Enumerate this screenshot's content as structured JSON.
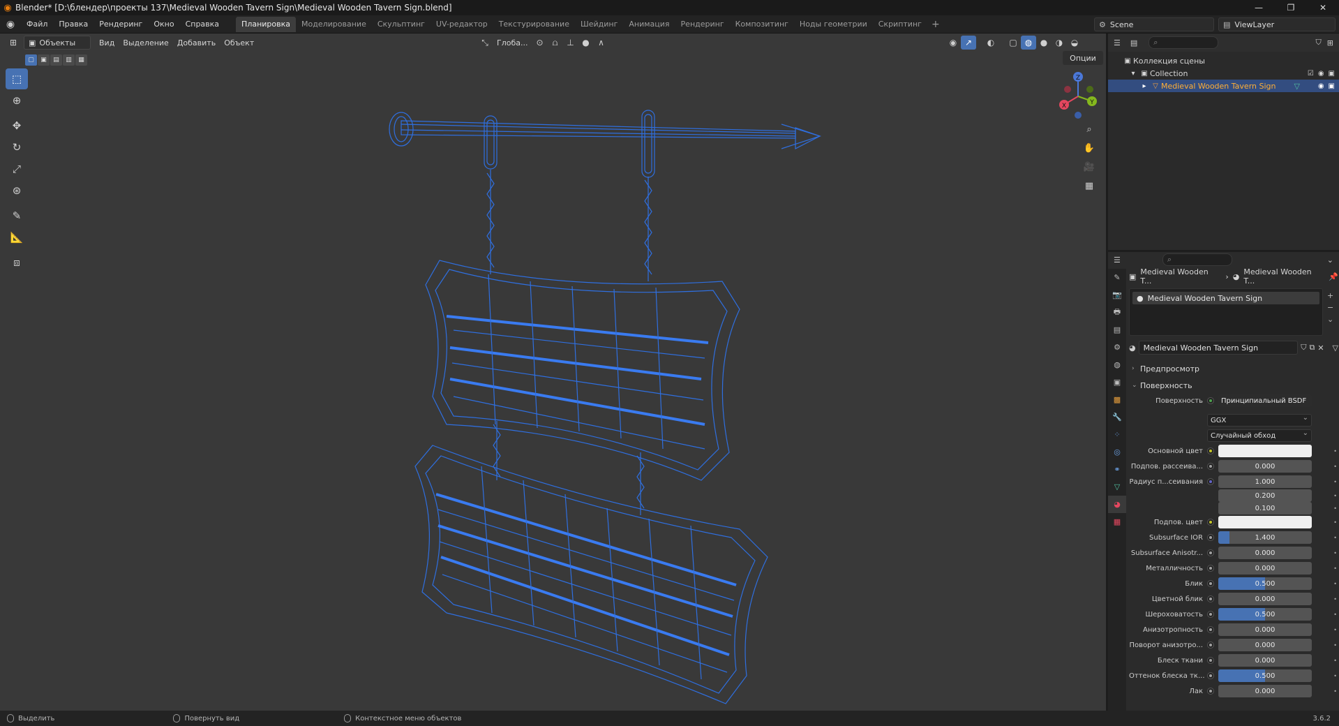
{
  "window": {
    "title": "Blender* [D:\\блендер\\проекты 137\\Medieval Wooden Tavern Sign\\Medieval Wooden Tavern Sign.blend]",
    "controls": [
      "—",
      "❐",
      "✕"
    ]
  },
  "menu": {
    "items": [
      "Файл",
      "Правка",
      "Рендеринг",
      "Окно",
      "Справка"
    ]
  },
  "workspaces": {
    "tabs": [
      "Планировка",
      "Моделирование",
      "Скульптинг",
      "UV-редактор",
      "Текстурирование",
      "Шейдинг",
      "Анимация",
      "Рендеринг",
      "Композитинг",
      "Ноды геометрии",
      "Скриптинг"
    ],
    "active": "Планировка"
  },
  "scene": {
    "name": "Scene"
  },
  "viewlayer": {
    "name": "ViewLayer"
  },
  "viewport": {
    "mode": "Объекты",
    "menus": [
      "Вид",
      "Выделение",
      "Добавить",
      "Объект"
    ],
    "orientation": "Глоба...",
    "options": "Опции",
    "wire_color": "#2f6fe0"
  },
  "gizmo": {
    "x": "X",
    "y": "Y",
    "z": "Z"
  },
  "outliner": {
    "root": "Коллекция сцены",
    "collection": "Collection",
    "object": "Medieval Wooden Tavern Sign"
  },
  "properties": {
    "breadcrumb_object": "Medieval Wooden T...",
    "breadcrumb_material": "Medieval Wooden T...",
    "slot": "Medieval Wooden Tavern Sign",
    "material": "Medieval Wooden Tavern Sign",
    "panels": {
      "preview": "Предпросмотр",
      "surface": "Поверхность"
    },
    "surface_label": "Поверхность",
    "surface_shader": "Принципиальный BSDF",
    "distribution": "GGX",
    "subsurface_method": "Случайный обход",
    "rows": [
      {
        "label": "Основной цвет",
        "value": "",
        "kind": "color",
        "dot": "yellow"
      },
      {
        "label": "Подпов. рассеива...",
        "value": "0.000",
        "kind": "num",
        "dot": "gray",
        "fill": 0
      },
      {
        "label": "Радиус п...сеивания",
        "value": "1.000",
        "kind": "num",
        "dot": "purple",
        "fill": 0
      },
      {
        "label": "",
        "value": "0.200",
        "kind": "num",
        "dot": "",
        "fill": 0
      },
      {
        "label": "",
        "value": "0.100",
        "kind": "num",
        "dot": "",
        "fill": 0
      },
      {
        "label": "Подпов. цвет",
        "value": "",
        "kind": "color",
        "dot": "yellow"
      },
      {
        "label": "Subsurface IOR",
        "value": "1.400",
        "kind": "num",
        "dot": "gray",
        "fill": 0.12
      },
      {
        "label": "Subsurface Anisotr...",
        "value": "0.000",
        "kind": "num",
        "dot": "gray",
        "fill": 0
      },
      {
        "label": "Металличность",
        "value": "0.000",
        "kind": "num",
        "dot": "gray",
        "fill": 0
      },
      {
        "label": "Блик",
        "value": "0.500",
        "kind": "num",
        "dot": "gray",
        "fill": 0.5
      },
      {
        "label": "Цветной блик",
        "value": "0.000",
        "kind": "num",
        "dot": "gray",
        "fill": 0
      },
      {
        "label": "Шероховатость",
        "value": "0.500",
        "kind": "num",
        "dot": "gray",
        "fill": 0.5
      },
      {
        "label": "Анизотропность",
        "value": "0.000",
        "kind": "num",
        "dot": "gray",
        "fill": 0
      },
      {
        "label": "Поворот анизотро...",
        "value": "0.000",
        "kind": "num",
        "dot": "gray",
        "fill": 0
      },
      {
        "label": "Блеск ткани",
        "value": "0.000",
        "kind": "num",
        "dot": "gray",
        "fill": 0
      },
      {
        "label": "Оттенок блеска тк...",
        "value": "0.500",
        "kind": "num",
        "dot": "gray",
        "fill": 0.5
      },
      {
        "label": "Лак",
        "value": "0.000",
        "kind": "num",
        "dot": "gray",
        "fill": 0
      }
    ]
  },
  "status": {
    "select": "Выделить",
    "rotate": "Повернуть вид",
    "context": "Контекстное меню объектов",
    "version": "3.6.2"
  }
}
